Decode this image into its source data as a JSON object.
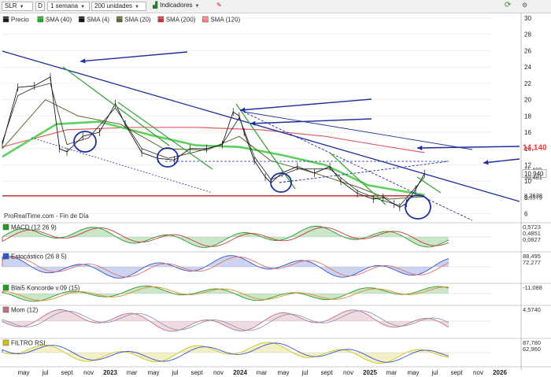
{
  "toolbar": {
    "symbol": "SLR",
    "d_button": "D",
    "period": "1 semana",
    "units": "200 unidades",
    "indicators": "Indicadores"
  },
  "legend": [
    {
      "label": "Precio",
      "color": "#1a1a1a"
    },
    {
      "label": "SMA (40)",
      "color": "#22aa22"
    },
    {
      "label": "SMA (4)",
      "color": "#111111"
    },
    {
      "label": "SMA (20)",
      "color": "#556b2f"
    },
    {
      "label": "SMA (200)",
      "color": "#cc3333"
    },
    {
      "label": "SMA (120)",
      "color": "#ff7f7f"
    }
  ],
  "colors": {
    "trendline": "#1e2f9e",
    "support": "#3aa63a",
    "resistance": "#cc2b2b",
    "alert": "#ff3333"
  },
  "chart_data": {
    "type": "line",
    "source_label": "ProRealTime.com - Fin de Día",
    "x_ticks": [
      "may",
      "jul",
      "sept",
      "nov",
      "2023",
      "mar",
      "may",
      "jul",
      "sept",
      "nov",
      "2024",
      "mar",
      "may",
      "jul",
      "sept",
      "nov",
      "2025",
      "mar",
      "may",
      "jul",
      "sept",
      "nov",
      "2026"
    ],
    "y_ticks": [
      "30",
      "28",
      "26",
      "24",
      "22",
      "20",
      "18",
      "16",
      "14",
      "12",
      "10",
      "8",
      "6"
    ],
    "ylim": [
      5,
      30
    ],
    "price_labels": [
      {
        "text": "14,140",
        "value": 14.14,
        "style": "alert"
      },
      {
        "text": "11,480",
        "value": 11.48,
        "style": "plain"
      },
      {
        "text": "10,940",
        "value": 10.94,
        "style": "box"
      },
      {
        "text": "10,481",
        "value": 10.48,
        "style": "plain"
      },
      {
        "text": "8,2628",
        "value": 8.26,
        "style": "plain"
      },
      {
        "text": "8,0579",
        "value": 8.06,
        "style": "plain"
      }
    ],
    "series": [
      {
        "name": "Precio",
        "x": [
          "2022-04-01",
          "2022-05-15",
          "2022-07-01",
          "2022-08-15",
          "2022-09-10",
          "2022-10-01",
          "2022-11-15",
          "2023-01-01",
          "2023-02-15",
          "2023-03-15",
          "2023-05-01",
          "2023-06-15",
          "2023-08-01",
          "2023-09-15",
          "2023-11-01",
          "2023-12-15",
          "2024-01-15",
          "2024-02-01",
          "2024-02-15",
          "2024-03-15",
          "2024-04-15",
          "2024-05-01",
          "2024-06-01",
          "2024-07-15",
          "2024-09-01",
          "2024-10-15",
          "2024-11-15",
          "2025-01-01",
          "2025-02-15",
          "2025-03-15",
          "2025-04-15",
          "2025-05-01",
          "2025-05-20",
          "2025-06-15",
          "2025-07-10"
        ],
        "values": [
          14.5,
          21.5,
          21.7,
          22.8,
          14.0,
          13.6,
          15.5,
          16.0,
          19.5,
          17.0,
          13.5,
          12.8,
          12.6,
          14.0,
          14.0,
          14.5,
          18.5,
          18.0,
          16.0,
          12.5,
          10.5,
          9.8,
          11.0,
          11.8,
          11.0,
          11.8,
          10.0,
          8.5,
          7.8,
          8.0,
          7.2,
          6.8,
          7.3,
          9.0,
          10.94
        ]
      },
      {
        "name": "SMA (40)",
        "x": [
          "2022-04-01",
          "2022-09-01",
          "2023-01-01",
          "2023-06-01",
          "2023-10-01",
          "2024-02-01",
          "2024-06-01",
          "2024-10-01",
          "2025-02-01",
          "2025-07-10"
        ],
        "values": [
          13.0,
          17.0,
          17.3,
          15.6,
          14.4,
          14.2,
          13.2,
          12.0,
          9.5,
          8.3
        ]
      },
      {
        "name": "SMA (4)",
        "x": [
          "2022-04-01",
          "2022-05-15",
          "2022-07-01",
          "2022-08-15",
          "2022-10-01",
          "2022-12-01",
          "2023-02-15",
          "2023-05-01",
          "2023-07-15",
          "2023-10-01",
          "2023-12-15",
          "2024-02-01",
          "2024-03-15",
          "2024-05-01",
          "2024-07-15",
          "2024-10-15",
          "2025-01-01",
          "2025-03-01",
          "2025-05-01",
          "2025-07-10"
        ],
        "values": [
          14.8,
          20.5,
          21.5,
          22.0,
          14.5,
          15.3,
          19.0,
          14.0,
          12.8,
          13.6,
          14.5,
          17.8,
          13.0,
          10.2,
          11.5,
          11.5,
          8.8,
          7.8,
          7.0,
          10.5
        ]
      },
      {
        "name": "SMA (20)",
        "x": [
          "2022-04-01",
          "2022-08-01",
          "2022-11-01",
          "2023-03-01",
          "2023-07-01",
          "2023-11-01",
          "2024-02-01",
          "2024-05-01",
          "2024-09-01",
          "2025-01-01",
          "2025-04-01",
          "2025-07-10"
        ],
        "values": [
          14.0,
          20.0,
          18.0,
          17.0,
          14.0,
          13.8,
          15.5,
          12.5,
          11.0,
          9.3,
          7.8,
          8.1
        ]
      },
      {
        "name": "SMA (200)",
        "x": [
          "2022-04-01",
          "2023-01-01",
          "2024-01-01",
          "2024-09-01",
          "2025-04-01",
          "2025-07-10"
        ],
        "values": [
          8.2,
          8.2,
          8.2,
          8.2,
          8.2,
          8.2
        ]
      },
      {
        "name": "SMA (120)",
        "x": [
          "2022-04-01",
          "2022-10-01",
          "2023-04-01",
          "2023-10-01",
          "2024-04-01",
          "2024-10-01",
          "2025-04-01",
          "2025-07-10"
        ],
        "values": [
          14.2,
          16.3,
          16.6,
          16.6,
          16.3,
          15.5,
          14.2,
          13.5
        ]
      }
    ],
    "panels": [
      {
        "name": "MACD (12 26 9)",
        "labels": [
          "0,5723",
          "0,4851",
          "0,0827"
        ]
      },
      {
        "name": "Estocástico (26 8 5)",
        "labels": [
          "88,495",
          "72,277"
        ]
      },
      {
        "name": "Blai5 Koncorde v.09 (15)",
        "labels": [
          "-11,088"
        ]
      },
      {
        "name": "Mom (12)",
        "labels": [
          "4,5740"
        ]
      },
      {
        "name": "FILTRO RSI",
        "labels": [
          "87,780",
          "62,960"
        ]
      }
    ]
  }
}
